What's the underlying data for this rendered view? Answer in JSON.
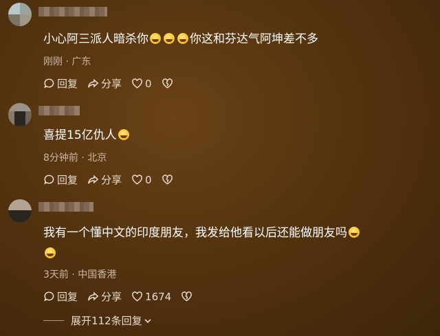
{
  "comments": [
    {
      "content_parts": [
        "小心阿三派人暗杀你",
        "你这和芬达气阿坤差不多"
      ],
      "time": "刚刚",
      "location": "广东",
      "reply_label": "回复",
      "share_label": "分享",
      "likes": "0"
    },
    {
      "content_parts": [
        "喜提15亿仇人"
      ],
      "time": "8分钟前",
      "location": "北京",
      "reply_label": "回复",
      "share_label": "分享",
      "likes": "0"
    },
    {
      "content_parts": [
        "我有一个懂中文的印度朋友，我发给他看以后还能做朋友吗"
      ],
      "time": "3天前",
      "location": "中国香港",
      "reply_label": "回复",
      "share_label": "分享",
      "likes": "1674"
    }
  ],
  "expand_replies": {
    "label": "展开112条回复"
  },
  "icons": {
    "reply": "comment-bubble-icon",
    "share": "share-arrow-icon",
    "like": "heart-icon",
    "dislike": "broken-heart-icon",
    "expand": "chevron-down-icon",
    "emoji": "laughing-emoji-icon"
  },
  "colors": {
    "background": "#54330f",
    "text": "#ffffff",
    "meta": "#c9b9a6",
    "action": "#e6dccf"
  }
}
